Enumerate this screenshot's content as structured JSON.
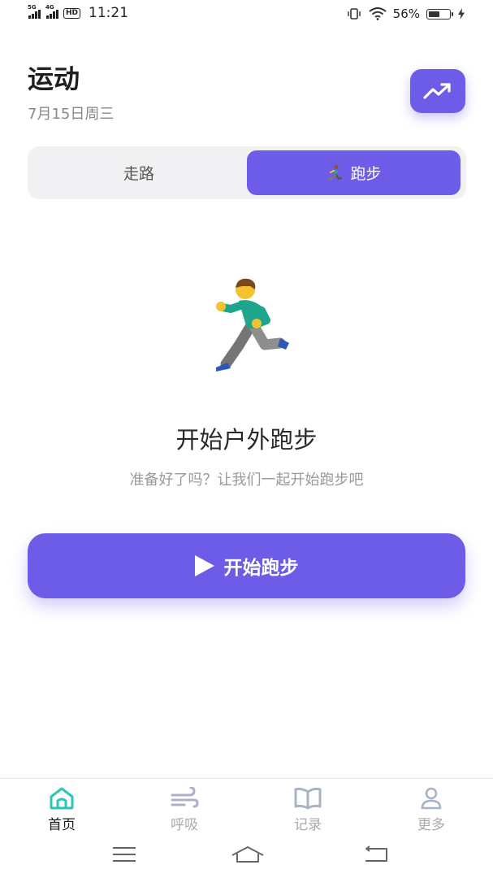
{
  "status_bar": {
    "network_1": "5G",
    "network_2": "4G",
    "hd_badge": "HD",
    "time": "11:21",
    "battery_text": "56%",
    "battery_level": 0.56
  },
  "header": {
    "title": "运动",
    "date": "7月15日周三",
    "trend_icon": "trending-up-icon"
  },
  "mode_tabs": {
    "walk_label": "走路",
    "run_label": "跑步",
    "selected": "run"
  },
  "main": {
    "illustration": "running-man-icon",
    "headline": "开始户外跑步",
    "subtitle": "准备好了吗？让我们一起开始跑步吧",
    "start_button_label": "开始跑步"
  },
  "bottom_nav": {
    "items": [
      {
        "label": "首页",
        "icon": "home-icon",
        "active": true
      },
      {
        "label": "呼吸",
        "icon": "wind-icon",
        "active": false
      },
      {
        "label": "记录",
        "icon": "book-icon",
        "active": false
      },
      {
        "label": "更多",
        "icon": "user-icon",
        "active": false
      }
    ]
  },
  "colors": {
    "accent": "#6c5ce7",
    "home_icon": "#2ec4b6",
    "inactive": "#aaaaaa"
  }
}
